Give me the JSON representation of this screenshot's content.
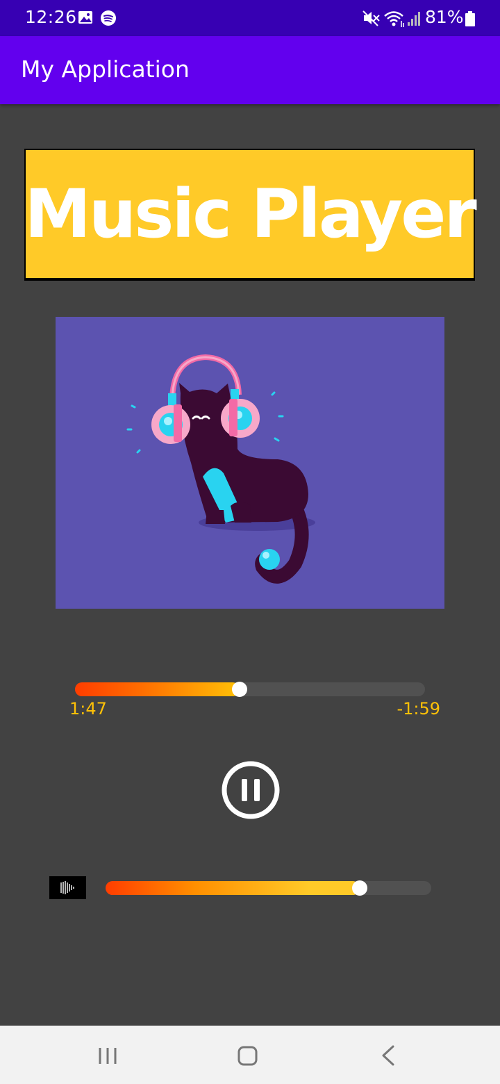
{
  "status_bar": {
    "time": "12:26",
    "battery_percent": "81%",
    "icons": [
      "gallery-icon",
      "spotify-icon",
      "mute-icon",
      "wifi-icon",
      "signal-icon",
      "battery-icon"
    ]
  },
  "app_bar": {
    "title": "My Application"
  },
  "banner": {
    "text": "Music Player",
    "background": "#ffca28"
  },
  "album_art": {
    "icon": "cat-with-headphones-illustration",
    "background": "#5c53b0"
  },
  "playback": {
    "elapsed": "1:47",
    "remaining": "-1:59",
    "progress": 0.47,
    "control_icon": "pause-icon"
  },
  "volume": {
    "icon": "volume-waveform-icon",
    "level": 0.78
  },
  "nav_bar": {
    "icons": [
      "recents-icon",
      "home-icon",
      "back-icon"
    ]
  },
  "colors": {
    "status_bar": "#3700b3",
    "app_bar": "#6200ee",
    "background": "#424242",
    "accent": "#ffc107"
  }
}
